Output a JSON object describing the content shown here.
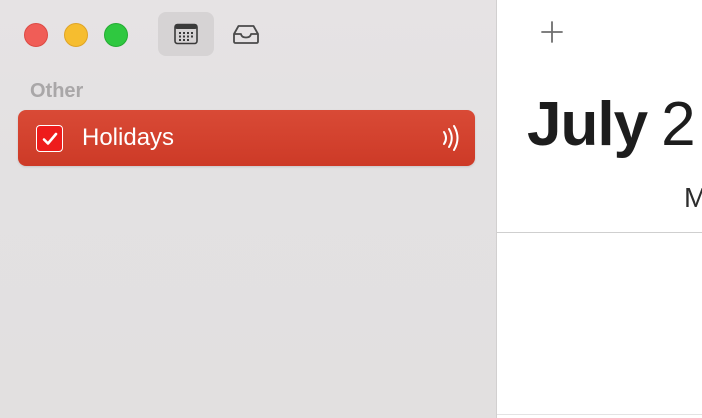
{
  "window": {
    "traffic_lights": {
      "close_color": "#f05d57",
      "minimize_color": "#f6bd2f",
      "maximize_color": "#2fc840"
    }
  },
  "toolbar": {
    "calendar_list_icon": "calendar-grid-icon",
    "inbox_icon": "inbox-tray-icon",
    "add_icon": "plus-icon"
  },
  "sidebar": {
    "section_title": "Other",
    "calendars": [
      {
        "name": "Holidays",
        "checked": true,
        "color": "#ee1c1c",
        "selected": true,
        "subscribed_icon": "broadcast-icon"
      }
    ],
    "selection_color": "#d24330"
  },
  "main": {
    "month": "July",
    "year": "2",
    "weekday": "M"
  }
}
